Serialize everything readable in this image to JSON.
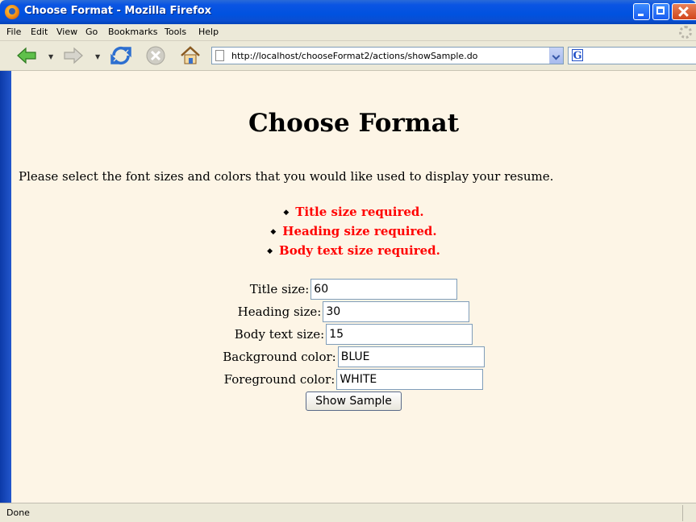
{
  "window": {
    "title": "Choose Format - Mozilla Firefox"
  },
  "menu": {
    "items": [
      "File",
      "Edit",
      "View",
      "Go",
      "Bookmarks",
      "Tools",
      "Help"
    ]
  },
  "toolbar": {
    "url": "http://localhost/chooseFormat2/actions/showSample.do",
    "search_value": ""
  },
  "page": {
    "title": "Choose Format",
    "intro": "Please select the font sizes and colors that you would like used to display your resume.",
    "errors": [
      "Title size required.",
      "Heading size required.",
      "Body text size required."
    ],
    "form": {
      "fields": [
        {
          "label": "Title size:",
          "value": "60"
        },
        {
          "label": "Heading size:",
          "value": "30"
        },
        {
          "label": "Body text size:",
          "value": "15"
        },
        {
          "label": "Background color:",
          "value": "BLUE"
        },
        {
          "label": "Foreground color:",
          "value": "WHITE"
        }
      ],
      "submit_label": "Show Sample"
    }
  },
  "status": {
    "text": "Done"
  },
  "colors": {
    "content_background": "#fdf5e6",
    "error_text": "#ff0000",
    "titlebar": "#0052df"
  },
  "icons": {
    "window": "firefox-icon",
    "back": "back-arrow-icon",
    "forward": "forward-arrow-icon",
    "reload": "reload-icon",
    "stop": "stop-icon",
    "home": "home-icon",
    "page": "page-icon",
    "search": "google-search-icon"
  }
}
